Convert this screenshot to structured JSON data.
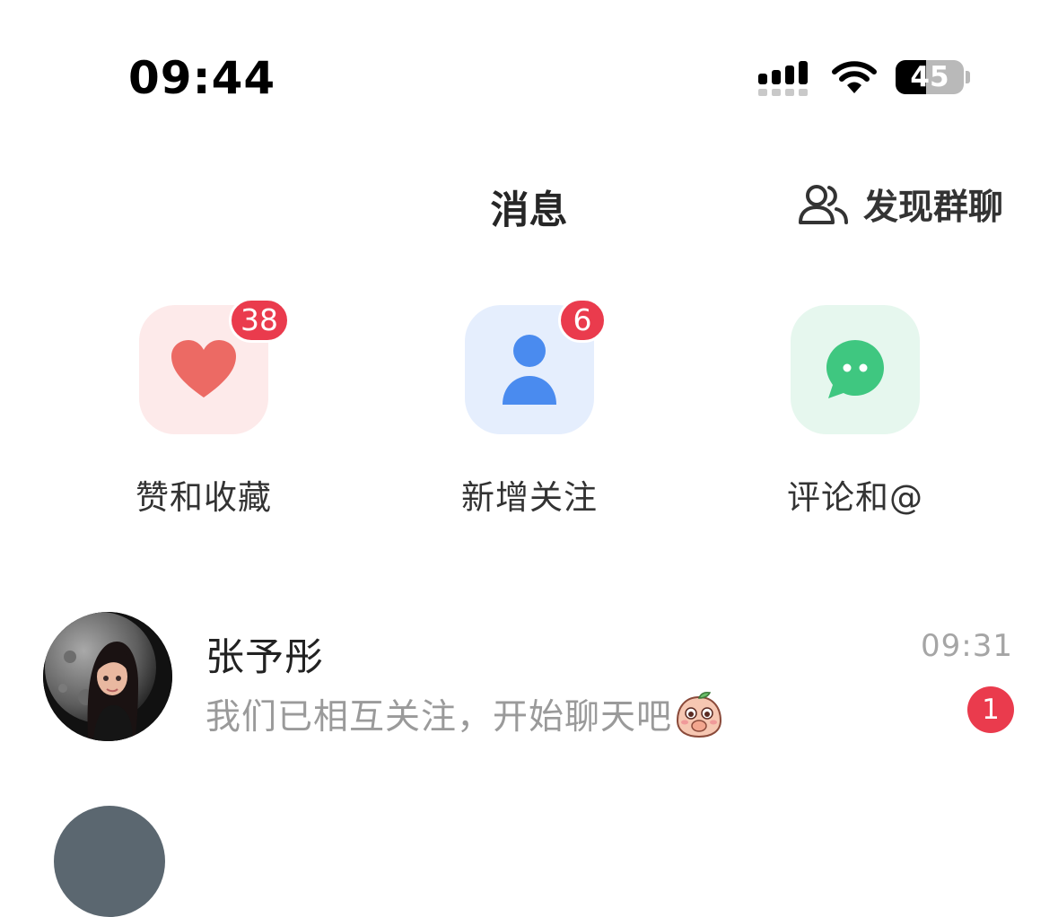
{
  "status_bar": {
    "time": "09:44",
    "battery_level": "45",
    "icons": [
      "cellular-signal-icon",
      "wifi-icon",
      "battery-icon"
    ]
  },
  "header": {
    "title": "消息",
    "discover_label": "发现群聊",
    "discover_icon": "group-people-icon"
  },
  "shortcuts": [
    {
      "label": "赞和收藏",
      "badge": "38",
      "icon": "heart-icon",
      "bg": "#fde9ea",
      "color": "#ec6a66"
    },
    {
      "label": "新增关注",
      "badge": "6",
      "icon": "person-icon",
      "bg": "#e6effe",
      "color": "#4a8df0"
    },
    {
      "label": "评论和@",
      "badge": "",
      "icon": "chat-bubble-icon",
      "bg": "#e6f7ee",
      "color": "#3fc780"
    }
  ],
  "conversations": [
    {
      "name": "张予彤",
      "preview": "我们已相互关注，开始聊天吧",
      "time": "09:31",
      "unread": "1",
      "emoji": "shy-peach-sticker-icon"
    }
  ],
  "colors": {
    "badge_red": "#ea3b4d",
    "muted_text": "#9a9a9a"
  }
}
